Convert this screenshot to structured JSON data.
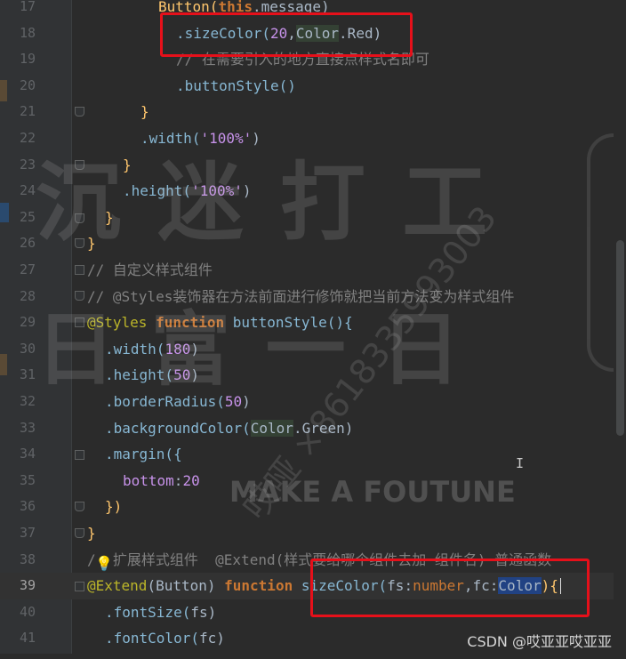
{
  "lines": [
    {
      "n": "17",
      "indent": 178,
      "tokens": [
        {
          "t": "Button(",
          "c": "tk-function"
        },
        {
          "t": "this",
          "c": "tk-keyword"
        },
        {
          "t": ".message)",
          "c": "tk-default"
        }
      ]
    },
    {
      "n": "18",
      "indent": 198,
      "tokens": [
        {
          "t": ".sizeColor(",
          "c": "tk-method"
        },
        {
          "t": "20",
          "c": "tk-number"
        },
        {
          "t": ",",
          "c": "tk-default"
        },
        {
          "t": "Color",
          "c": "tk-hilite"
        },
        {
          "t": ".Red)",
          "c": "tk-default"
        }
      ]
    },
    {
      "n": "19",
      "indent": 198,
      "tokens": [
        {
          "t": "// 在需要引入的地方直接点样式名即可",
          "c": "tk-comment"
        }
      ]
    },
    {
      "n": "20",
      "indent": 198,
      "tokens": [
        {
          "t": ".buttonStyle()",
          "c": "tk-method"
        }
      ]
    },
    {
      "n": "21",
      "indent": 158,
      "tokens": [
        {
          "t": "}",
          "c": "tk-function"
        }
      ]
    },
    {
      "n": "22",
      "indent": 158,
      "tokens": [
        {
          "t": ".width(",
          "c": "tk-method"
        },
        {
          "t": "'100%'",
          "c": "tk-string"
        },
        {
          "t": ")",
          "c": "tk-default"
        }
      ]
    },
    {
      "n": "23",
      "indent": 138,
      "tokens": [
        {
          "t": "}",
          "c": "tk-function"
        }
      ]
    },
    {
      "n": "24",
      "indent": 138,
      "tokens": [
        {
          "t": ".height(",
          "c": "tk-method"
        },
        {
          "t": "'100%'",
          "c": "tk-string"
        },
        {
          "t": ")",
          "c": "tk-default"
        }
      ]
    },
    {
      "n": "25",
      "indent": 118,
      "tokens": [
        {
          "t": "}",
          "c": "tk-function"
        }
      ]
    },
    {
      "n": "26",
      "indent": 98,
      "tokens": [
        {
          "t": "}",
          "c": "tk-function"
        }
      ]
    },
    {
      "n": "27",
      "indent": 98,
      "tokens": [
        {
          "t": "// 自定义样式组件",
          "c": "tk-comment"
        }
      ]
    },
    {
      "n": "28",
      "indent": 98,
      "tokens": [
        {
          "t": "// @Styles装饰器在方法前面进行修饰就把当前方法变为样式组件",
          "c": "tk-comment"
        }
      ]
    },
    {
      "n": "29",
      "indent": 98,
      "tokens": [
        {
          "t": "@Styles ",
          "c": "tk-decorator"
        },
        {
          "t": "function ",
          "c": "tk-keyword"
        },
        {
          "t": "buttonStyle(){",
          "c": "tk-method"
        }
      ]
    },
    {
      "n": "30",
      "indent": 118,
      "tokens": [
        {
          "t": ".width(",
          "c": "tk-method"
        },
        {
          "t": "180",
          "c": "tk-number"
        },
        {
          "t": ")",
          "c": "tk-default"
        }
      ]
    },
    {
      "n": "31",
      "indent": 118,
      "tokens": [
        {
          "t": ".height(",
          "c": "tk-method"
        },
        {
          "t": "50",
          "c": "tk-number"
        },
        {
          "t": ")",
          "c": "tk-default"
        }
      ]
    },
    {
      "n": "32",
      "indent": 118,
      "tokens": [
        {
          "t": ".borderRadius(",
          "c": "tk-method"
        },
        {
          "t": "50",
          "c": "tk-number"
        },
        {
          "t": ")",
          "c": "tk-default"
        }
      ]
    },
    {
      "n": "33",
      "indent": 118,
      "tokens": [
        {
          "t": ".backgroundColor(",
          "c": "tk-method"
        },
        {
          "t": "Color",
          "c": "tk-hilite"
        },
        {
          "t": ".Green)",
          "c": "tk-default"
        }
      ]
    },
    {
      "n": "34",
      "indent": 118,
      "tokens": [
        {
          "t": ".margin({",
          "c": "tk-method"
        }
      ]
    },
    {
      "n": "35",
      "indent": 138,
      "tokens": [
        {
          "t": "bottom",
          "c": "tk-prop"
        },
        {
          "t": ":",
          "c": "tk-default"
        },
        {
          "t": "20",
          "c": "tk-number"
        }
      ]
    },
    {
      "n": "36",
      "indent": 118,
      "tokens": [
        {
          "t": "})",
          "c": "tk-function"
        }
      ]
    },
    {
      "n": "37",
      "indent": 98,
      "tokens": [
        {
          "t": "}",
          "c": "tk-function"
        }
      ]
    },
    {
      "n": "38",
      "indent": 98,
      "tokens": [
        {
          "t": "/  扩展样式组件  @Extend(样式要给哪个组件去加 组件名) 普通函数",
          "c": "tk-comment"
        }
      ]
    },
    {
      "n": "39",
      "indent": 98,
      "current": true,
      "tokens": [
        {
          "t": "@Extend",
          "c": "tk-decorator"
        },
        {
          "t": "(Button) ",
          "c": "tk-default"
        },
        {
          "t": "function ",
          "c": "tk-keyword"
        },
        {
          "t": "sizeColor(",
          "c": "tk-method"
        },
        {
          "t": "fs",
          "c": "tk-default"
        },
        {
          "t": ":",
          "c": "tk-default"
        },
        {
          "t": "number",
          "c": "tk-type"
        },
        {
          "t": ",",
          "c": "tk-default"
        },
        {
          "t": "fc",
          "c": "tk-default"
        },
        {
          "t": ":",
          "c": "tk-default"
        },
        {
          "t": "Color",
          "c": "tk-select"
        },
        {
          "t": "){",
          "c": "tk-function"
        }
      ]
    },
    {
      "n": "40",
      "indent": 118,
      "tokens": [
        {
          "t": ".fontSize(",
          "c": "tk-method"
        },
        {
          "t": "fs",
          "c": "tk-default"
        },
        {
          "t": ")",
          "c": "tk-default"
        }
      ]
    },
    {
      "n": "41",
      "indent": 118,
      "tokens": [
        {
          "t": ".fontColor(",
          "c": "tk-method"
        },
        {
          "t": "fc",
          "c": "tk-default"
        },
        {
          "t": ")",
          "c": "tk-default"
        }
      ]
    }
  ],
  "watermark": {
    "row1": "沉 迷 打 工",
    "row2": "日 富 一 日",
    "diagonal": "哎哑 ×8618335993003",
    "slogan": "MAKE A FOUTUNE"
  },
  "credit": "CSDN @哎亚亚哎亚亚",
  "colors": {
    "highlight_box": "#e6101a",
    "background": "#2b2b2b"
  }
}
